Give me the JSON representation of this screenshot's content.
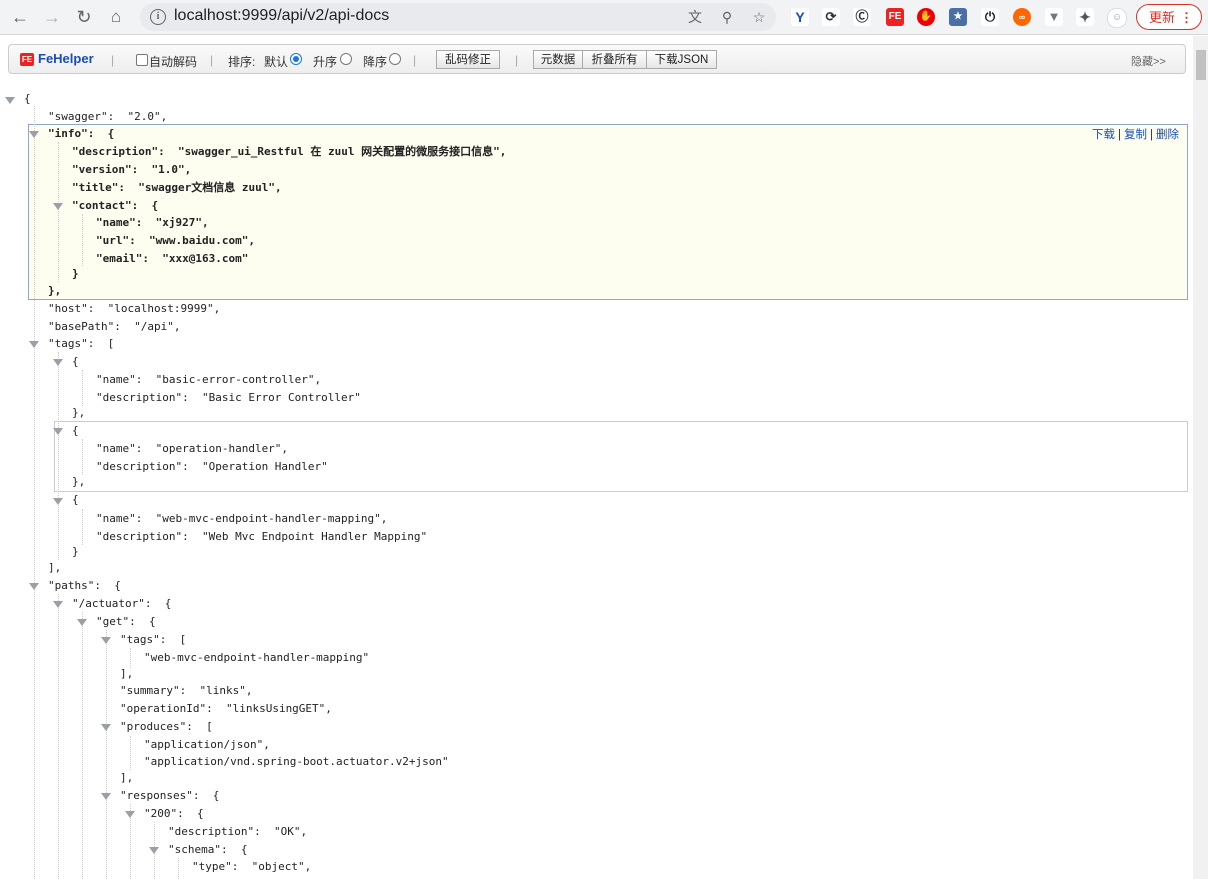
{
  "browser": {
    "url": "localhost:9999/api/v2/api-docs",
    "update_label": "更新"
  },
  "fehelper": {
    "title": "FeHelper",
    "auto_decode_label": "自动解码",
    "sort_label": "排序:",
    "sort_default": "默认",
    "sort_asc": "升序",
    "sort_desc": "降序",
    "fix_encoding": "乱码修正",
    "metadata": "元数据",
    "collapse_all": "折叠所有",
    "download_json": "下载JSON",
    "hide": "隐藏>>"
  },
  "node_actions": {
    "download": "下载",
    "copy": "复制",
    "delete": "删除"
  },
  "json": {
    "l0": "{",
    "l1": "\"swagger\":  \"2.0\",",
    "l2": "\"info\":  {",
    "l3": "\"description\":  \"swagger_ui_Restful 在 zuul 网关配置的微服务接口信息\",",
    "l4": "\"version\":  \"1.0\",",
    "l5": "\"title\":  \"swagger文档信息 zuul\",",
    "l6": "\"contact\":  {",
    "l7": "\"name\":  \"xj927\",",
    "l8": "\"url\":  \"www.baidu.com\",",
    "l9": "\"email\":  \"xxx@163.com\"",
    "l10": "}",
    "l11": "},",
    "l12": "\"host\":  \"localhost:9999\",",
    "l13": "\"basePath\":  \"/api\",",
    "l14": "\"tags\":  [",
    "l15": "{",
    "l16": "\"name\":  \"basic-error-controller\",",
    "l17": "\"description\":  \"Basic Error Controller\"",
    "l18": "},",
    "l19": "{",
    "l20": "\"name\":  \"operation-handler\",",
    "l21": "\"description\":  \"Operation Handler\"",
    "l22": "},",
    "l23": "{",
    "l24": "\"name\":  \"web-mvc-endpoint-handler-mapping\",",
    "l25": "\"description\":  \"Web Mvc Endpoint Handler Mapping\"",
    "l26": "}",
    "l27": "],",
    "l28": "\"paths\":  {",
    "l29": "\"/actuator\":  {",
    "l30": "\"get\":  {",
    "l31": "\"tags\":  [",
    "l32": "\"web-mvc-endpoint-handler-mapping\"",
    "l33": "],",
    "l34": "\"summary\":  \"links\",",
    "l35": "\"operationId\":  \"linksUsingGET\",",
    "l36": "\"produces\":  [",
    "l37": "\"application/json\",",
    "l38": "\"application/vnd.spring-boot.actuator.v2+json\"",
    "l39": "],",
    "l40": "\"responses\":  {",
    "l41": "\"200\":  {",
    "l42": "\"description\":  \"OK\",",
    "l43": "\"schema\":  {",
    "l44": "\"type\":  \"object\","
  }
}
